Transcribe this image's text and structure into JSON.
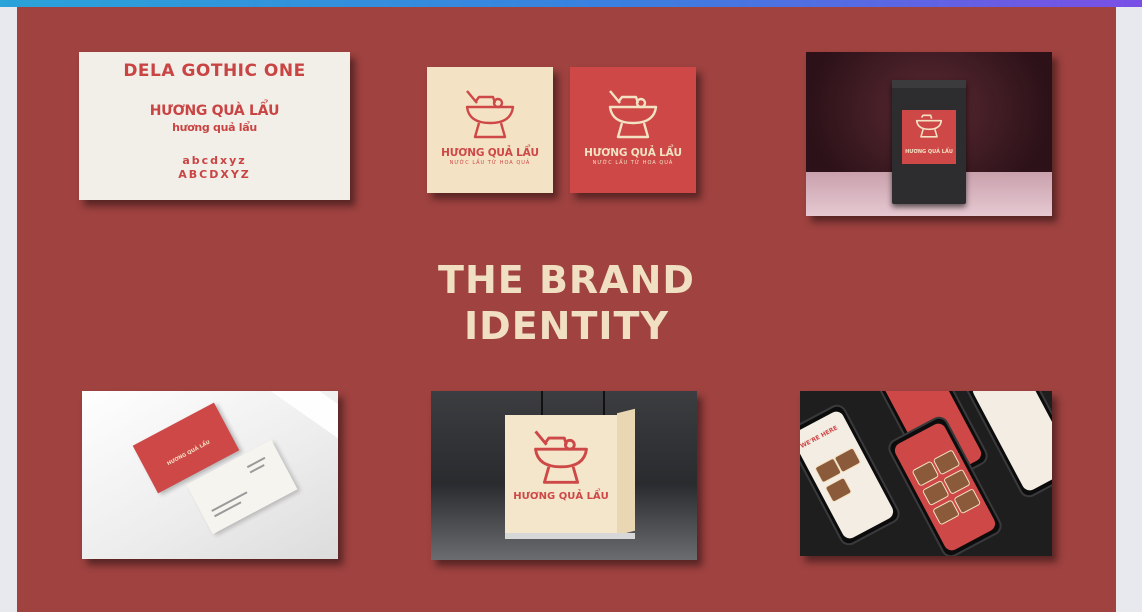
{
  "typography": {
    "font_name": "DELA GOTHIC ONE",
    "brand_name": "HƯƠNG QUÀ LẨU",
    "brand_name_lower": "hương quả lẩu",
    "lowercase_sample": "abcdxyz",
    "uppercase_sample": "ABCDXYZ"
  },
  "logos": {
    "cream": {
      "name": "HƯƠNG QUẢ LẨU",
      "tagline": "NƯỚC LẨU TỪ HOA QUẢ"
    },
    "red": {
      "name": "HƯƠNG QUẢ LẨU",
      "tagline": "NƯỚC LẨU TỪ HOA QUẢ"
    }
  },
  "bag": {
    "label": "HƯƠNG QUẢ LẨU"
  },
  "title": {
    "line1": "THE BRAND",
    "line2": "IDENTITY"
  },
  "business_card": {
    "label": "HƯƠNG QUẢ LẨU"
  },
  "lightbox": {
    "label": "HƯƠNG QUẢ LẨU"
  },
  "app": {
    "welcome": "WE'RE HERE"
  },
  "colors": {
    "slide_bg": "#9f4240",
    "brand_red": "#cd4847",
    "brand_cream": "#f3e2c3",
    "title": "#f1dfc1"
  },
  "icons": {
    "logo": "hotpot-icon"
  }
}
